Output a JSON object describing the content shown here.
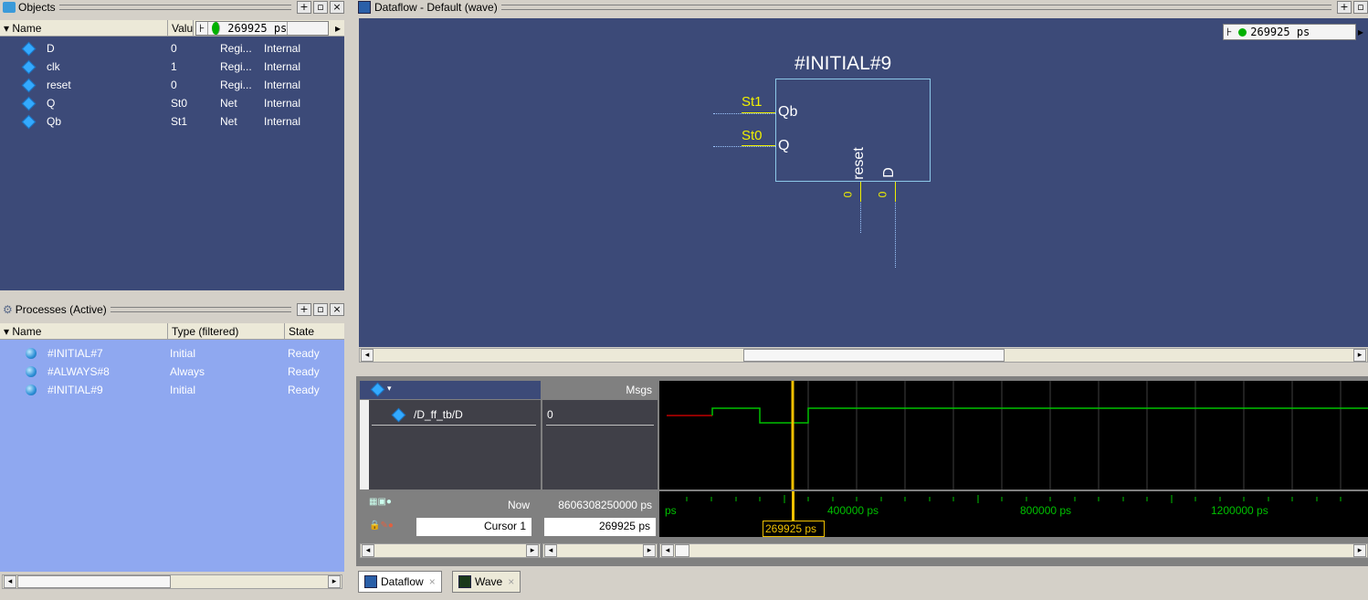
{
  "objects": {
    "title": "Objects",
    "time": "269925 ps",
    "columns": [
      "Name",
      "Valu",
      ""
    ],
    "rows": [
      {
        "name": "D",
        "value": "0",
        "kind": "Regi...",
        "mode": "Internal"
      },
      {
        "name": "clk",
        "value": "1",
        "kind": "Regi...",
        "mode": "Internal"
      },
      {
        "name": "reset",
        "value": "0",
        "kind": "Regi...",
        "mode": "Internal"
      },
      {
        "name": "Q",
        "value": "St0",
        "kind": "Net",
        "mode": "Internal"
      },
      {
        "name": "Qb",
        "value": "St1",
        "kind": "Net",
        "mode": "Internal"
      }
    ]
  },
  "processes": {
    "title": "Processes (Active)",
    "columns": [
      "Name",
      "Type (filtered)",
      "State"
    ],
    "rows": [
      {
        "name": "#INITIAL#7",
        "type": "Initial",
        "state": "Ready"
      },
      {
        "name": "#ALWAYS#8",
        "type": "Always",
        "state": "Ready"
      },
      {
        "name": "#INITIAL#9",
        "type": "Initial",
        "state": "Ready"
      }
    ]
  },
  "dataflow": {
    "title": "Dataflow - Default (wave)",
    "time": "269925 ps",
    "block_name": "#INITIAL#9",
    "ports": [
      {
        "label": "Qb",
        "value": "St1"
      },
      {
        "label": "Q",
        "value": "St0"
      }
    ],
    "bottom_ports": [
      {
        "label": "reset",
        "value": "0"
      },
      {
        "label": "D",
        "value": "0"
      }
    ]
  },
  "wave": {
    "msgs_label": "Msgs",
    "signal": "/D_ff_tb/D",
    "signal_value": "0",
    "now_label": "Now",
    "now_value": "8606308250000 ps",
    "cursor_label": "Cursor 1",
    "cursor_value": "269925 ps",
    "cursor_flag": "269925 ps",
    "ticks": [
      "ps",
      "400000 ps",
      "800000 ps",
      "1200000 ps"
    ]
  },
  "tabs": [
    {
      "label": "Dataflow"
    },
    {
      "label": "Wave"
    }
  ],
  "colors": {
    "panel_blue": "#3c4a78",
    "process_blue": "#8fa8f0",
    "wave_green": "#00c000",
    "cursor_yellow": "#f0c000",
    "signal_yellow": "#f0f000"
  }
}
